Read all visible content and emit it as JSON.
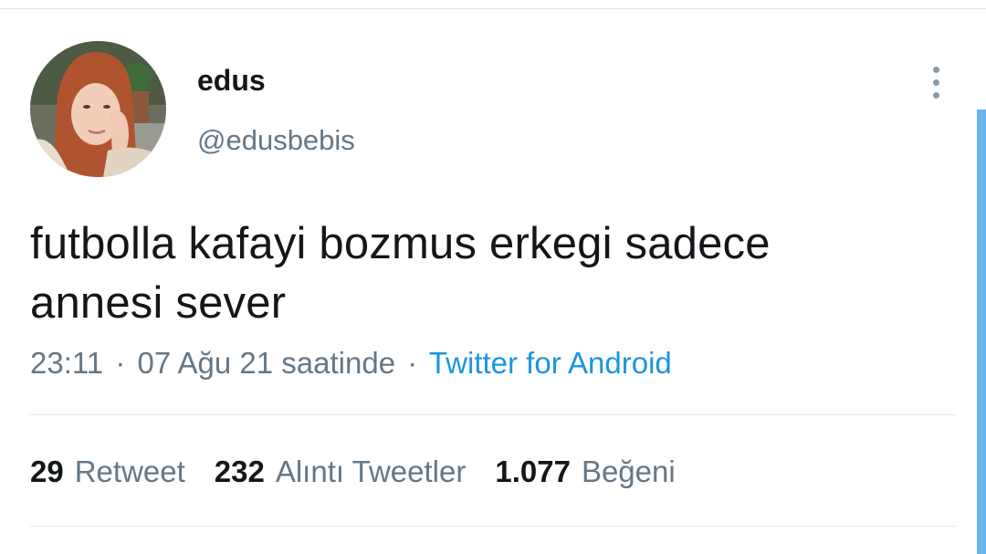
{
  "author": {
    "display_name": "edus",
    "handle": "@edusbebis",
    "avatar_icon": "profile-photo"
  },
  "tweet": {
    "text_line1": "futbolla kafayi bozmus erkegi sadece",
    "text_line2": "annesi sever",
    "time": "23:11",
    "date": "07 Ağu 21 saatinde",
    "separator": "·",
    "source": "Twitter for Android"
  },
  "stats": {
    "retweets_count": "29",
    "retweets_label": "Retweet",
    "quotes_count": "232",
    "quotes_label": "Alıntı Tweetler",
    "likes_count": "1.077",
    "likes_label": "Beğeni"
  },
  "colors": {
    "text_primary": "#14171a",
    "text_secondary": "#657786",
    "link": "#1b95e0",
    "divider": "#e1e8ed",
    "scrollbar": "#6cb4ee"
  }
}
